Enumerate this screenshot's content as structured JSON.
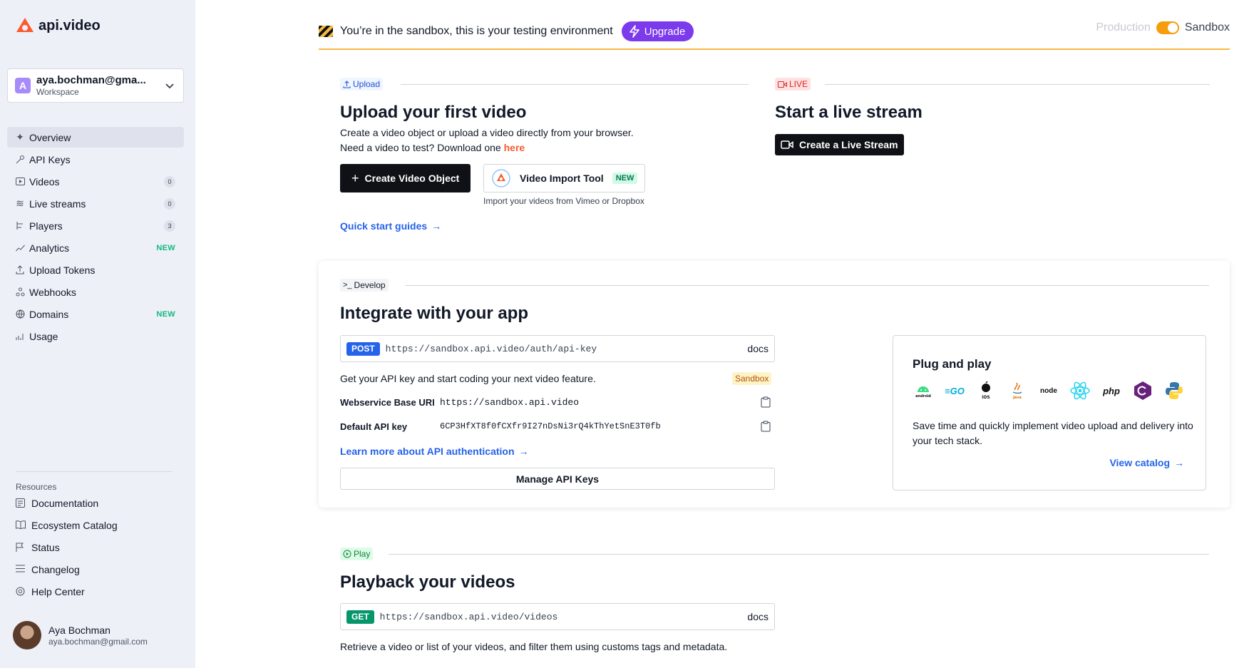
{
  "brand": {
    "name": "api.video",
    "accent": "#fa5b30"
  },
  "workspace": {
    "initial": "A",
    "name": "aya.bochman@gma...",
    "sub": "Workspace"
  },
  "nav": [
    {
      "label": "Overview",
      "icon": "sparkle-icon",
      "active": true
    },
    {
      "label": "API Keys",
      "icon": "key-icon"
    },
    {
      "label": "Videos",
      "icon": "video-icon",
      "count": "0"
    },
    {
      "label": "Live streams",
      "icon": "wifi-icon",
      "count": "0"
    },
    {
      "label": "Players",
      "icon": "player-icon",
      "count": "3"
    },
    {
      "label": "Analytics",
      "icon": "analytics-icon",
      "badge": "NEW"
    },
    {
      "label": "Upload Tokens",
      "icon": "upload-icon"
    },
    {
      "label": "Webhooks",
      "icon": "webhook-icon"
    },
    {
      "label": "Domains",
      "icon": "globe-icon",
      "badge": "NEW"
    },
    {
      "label": "Usage",
      "icon": "bar-chart-icon"
    }
  ],
  "resources": {
    "title": "Resources",
    "items": [
      {
        "label": "Documentation",
        "icon": "doc-icon"
      },
      {
        "label": "Ecosystem Catalog",
        "icon": "book-icon"
      },
      {
        "label": "Status",
        "icon": "flag-icon"
      },
      {
        "label": "Changelog",
        "icon": "list-icon"
      },
      {
        "label": "Help Center",
        "icon": "lifebuoy-icon"
      }
    ]
  },
  "user": {
    "name": "Aya Bochman",
    "email": "aya.bochman@gmail.com"
  },
  "banner": {
    "message": "You’re in the sandbox, this is your testing environment",
    "upgrade": "Upgrade",
    "env_production": "Production",
    "env_sandbox": "Sandbox"
  },
  "upload": {
    "tag": "Upload",
    "title": "Upload your first video",
    "line1": "Create a video object or upload a video directly from your browser.",
    "line2": "Need a video to test? Download one",
    "line2_link": "here",
    "create_btn": "Create Video Object",
    "import_btn": "Video Import Tool",
    "import_badge": "NEW",
    "import_caption": "Import your videos from Vimeo or Dropbox",
    "guides_link": "Quick start guides"
  },
  "live": {
    "tag": "LIVE",
    "title": "Start a live stream",
    "button": "Create a Live Stream"
  },
  "develop": {
    "tag": "Develop",
    "title": "Integrate with your app",
    "method": "POST",
    "url": "https://sandbox.api.video/auth/api-key",
    "docs": "docs",
    "desc": "Get your API key and start coding your next video feature.",
    "env_pill": "Sandbox",
    "base_uri_label": "Webservice Base URI",
    "base_uri_value": "https://sandbox.api.video",
    "api_key_label": "Default API key",
    "api_key_value": "6CP3HfXT8f0fCXfr9I27nDsNi3rQ4kThYetSnE3T0fb",
    "auth_link": "Learn more about API authentication",
    "manage_btn": "Manage API Keys"
  },
  "plug": {
    "title": "Plug and play",
    "techs": [
      "android",
      "go",
      "iOS",
      "java",
      "node",
      "react",
      "php",
      "csharp",
      "python"
    ],
    "desc": "Save time and quickly implement video upload and delivery into your tech stack.",
    "link": "View catalog"
  },
  "play": {
    "tag": "Play",
    "title": "Playback your videos",
    "method": "GET",
    "url": "https://sandbox.api.video/videos",
    "docs": "docs",
    "desc": "Retrieve a video or list of your videos, and filter them using customs tags and metadata."
  }
}
